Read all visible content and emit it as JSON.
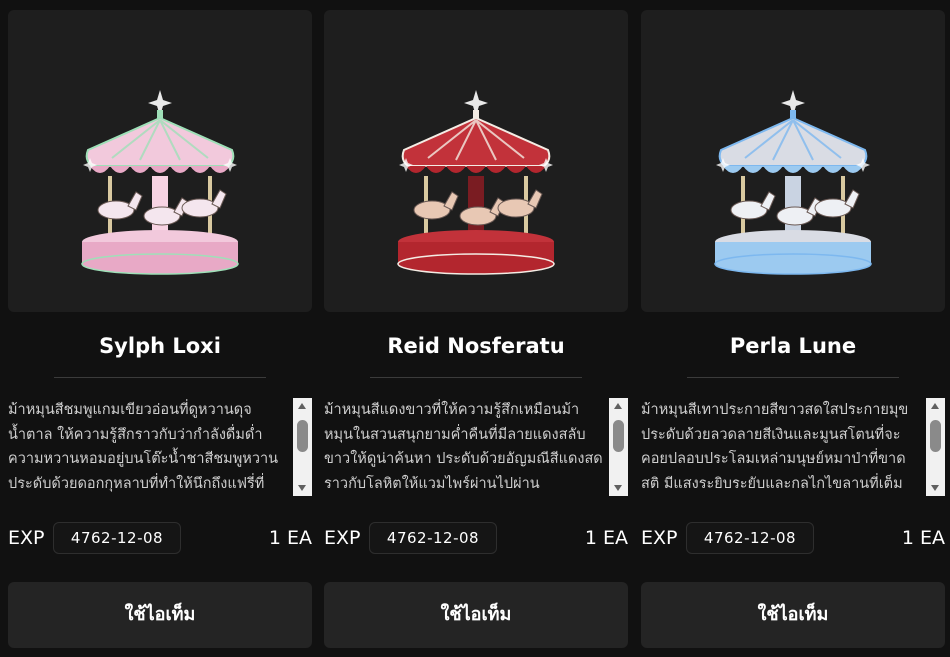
{
  "items": [
    {
      "name": "Sylph Loxi",
      "description": "ม้าหมุนสีชมพูแกมเขียวอ่อนที่ดูหวานดุจน้ำตาล ให้ความรู้สึกราวกับว่ากำลังดื่มด่ำความหวานหอมอยู่บนโต๊ะน้ำชาสีชมพูหวาน ประดับด้วยดอกกุหลาบที่ทำให้นึกถึงแฟรี่ที่",
      "exp_label": "EXP",
      "exp_date": "4762-12-08",
      "quantity": "1 EA",
      "button_label": "ใช้ไอเท็ม",
      "theme": {
        "roof": "#f2c9dc",
        "roof_accent": "#9fe0b8",
        "body": "#f7d3e3",
        "base": "#e8a9c6",
        "horse": "#f4e6ee"
      }
    },
    {
      "name": "Reid Nosferatu",
      "description": "ม้าหมุนสีแดงขาวที่ให้ความรู้สึกเหมือนม้าหมุนในสวนสนุกยามค่ำคืนที่มีลายแดงสลับขาวให้ดูน่าค้นหา ประดับด้วยอัญมณีสีแดงสดราวกับโลหิตให้แวมไพร์ผ่านไปผ่าน",
      "exp_label": "EXP",
      "exp_date": "4762-12-08",
      "quantity": "1 EA",
      "button_label": "ใช้ไอเท็ม",
      "theme": {
        "roof": "#c2323a",
        "roof_accent": "#f4ece4",
        "body": "#7a1c22",
        "base": "#b3262e",
        "horse": "#e8c8b4"
      }
    },
    {
      "name": "Perla Lune",
      "description": "ม้าหมุนสีเทาประกายสีขาวสดใสประกายมุขประดับด้วยลวดลายสีเงินและมูนสโตนที่จะคอยปลอบประโลมเหล่ามนุษย์หมาป่าที่ขาดสติ มีแสงระยิบระยับและกลไกไขลานที่เต็ม",
      "exp_label": "EXP",
      "exp_date": "4762-12-08",
      "quantity": "1 EA",
      "button_label": "ใช้ไอเท็ม",
      "theme": {
        "roof": "#d9dce4",
        "roof_accent": "#7db8ef",
        "body": "#c9d3e2",
        "base": "#9ccaf0",
        "horse": "#eef0f4"
      }
    }
  ]
}
